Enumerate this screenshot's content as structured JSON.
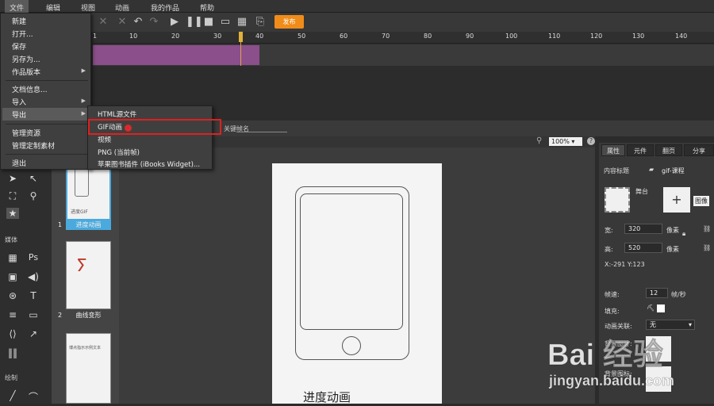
{
  "menubar": {
    "items": [
      {
        "label": "文件"
      },
      {
        "label": "编辑"
      },
      {
        "label": "视图"
      },
      {
        "label": "动画"
      },
      {
        "label": "我的作品"
      },
      {
        "label": "帮助"
      }
    ]
  },
  "toolbar": {
    "publish_label": "发布",
    "play_icon": "play-icon",
    "pause_icon": "pause-icon"
  },
  "file_menu": {
    "items": [
      {
        "label": "新建"
      },
      {
        "label": "打开..."
      },
      {
        "label": "保存"
      },
      {
        "label": "另存为..."
      },
      {
        "label": "作品版本"
      },
      {
        "label": "文档信息..."
      },
      {
        "label": "导入"
      },
      {
        "label": "导出"
      },
      {
        "label": "管理资源"
      },
      {
        "label": "管理定制素材"
      },
      {
        "label": "退出"
      }
    ]
  },
  "export_submenu": {
    "items": [
      {
        "label": "HTML源文件"
      },
      {
        "label": "GIF动画"
      },
      {
        "label": "视频"
      },
      {
        "label": "PNG (当前帧)"
      },
      {
        "label": "苹果图书插件 (iBooks Widget)..."
      }
    ],
    "highlighted": "GIF动画"
  },
  "timeline": {
    "ticks": [
      "1",
      "10",
      "20",
      "30",
      "40",
      "50",
      "60",
      "70",
      "80",
      "90",
      "100",
      "110",
      "120",
      "130",
      "140"
    ],
    "name_label": "关键帧名"
  },
  "stage": {
    "zoom": "100%",
    "help": "?",
    "text": "进度动画"
  },
  "pages": [
    {
      "number": "1",
      "caption": "进度动画",
      "thumb_text": "进度GIF"
    },
    {
      "number": "2",
      "caption": "曲线变形",
      "thumb_text": ""
    },
    {
      "number": "",
      "caption": "",
      "thumb_text": "博点指示示例文本"
    }
  ],
  "left_panel": {
    "section_media": "媒体",
    "section_draw": "绘制"
  },
  "right_panel": {
    "tabs": [
      {
        "label": "属性"
      },
      {
        "label": "元件"
      },
      {
        "label": "翻页"
      },
      {
        "label": "分享"
      }
    ],
    "content_title_label": "内容标题",
    "content_title_value": "gif-课程",
    "stage_label": "舞台",
    "image_label": "图像",
    "width_label": "宽:",
    "width_value": "320",
    "height_label": "高:",
    "height_value": "520",
    "px_unit": "像素",
    "position": "X:-291  Y:123",
    "fps_label": "帧速:",
    "fps_value": "12",
    "fps_unit": "帧/秒",
    "fill_label": "填充:",
    "anim_label": "动画关联:",
    "anim_value": "无",
    "bg_label": "背景图片:",
    "bg_icon_label": "背景图标:"
  },
  "watermark": {
    "brand": "Bai 经验",
    "site": "jingyan.baidu.com"
  }
}
